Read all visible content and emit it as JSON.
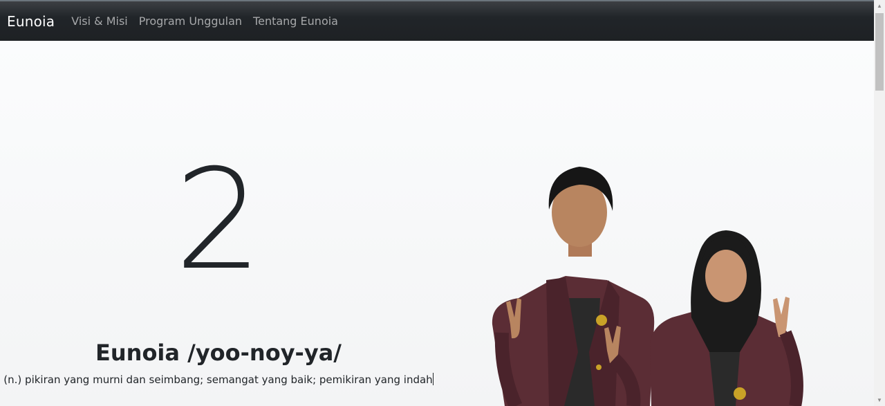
{
  "navbar": {
    "brand": "Eunoia",
    "links": [
      "Visi & Misi",
      "Program Unggulan",
      "Tentang Eunoia"
    ]
  },
  "hero": {
    "number": "2",
    "title": "Eunoia /yoo-noy-ya/",
    "definition": "(n.) pikiran yang murni dan seimbang; semangat yang baik; pemikiran yang indah"
  },
  "colors": {
    "navbar_bg": "#212529",
    "jacket": "#5b2d35",
    "text": "#212529"
  },
  "icons": {
    "scroll_up": "▲",
    "scroll_down": "▼"
  }
}
